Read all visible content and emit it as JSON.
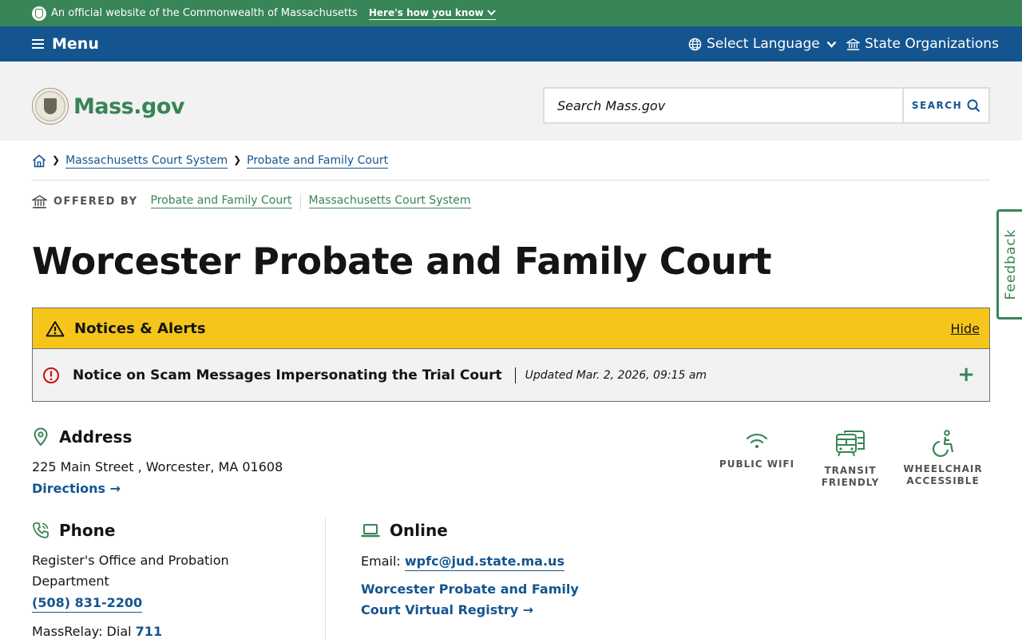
{
  "official_bar": {
    "text": "An official website of the Commonwealth of Massachusetts",
    "how_link": "Here's how you know"
  },
  "nav": {
    "menu_label": "Menu",
    "language_label": "Select Language",
    "orgs_label": "State Organizations"
  },
  "header": {
    "logo_text": "Mass.gov",
    "search_placeholder": "Search Mass.gov",
    "search_button": "SEARCH"
  },
  "breadcrumb": {
    "items": [
      "Massachusetts Court System",
      "Probate and Family Court"
    ]
  },
  "offered_by": {
    "label": "OFFERED BY",
    "links": [
      "Probate and Family Court",
      "Massachusetts Court System"
    ]
  },
  "page_title": "Worcester Probate and Family Court",
  "alerts": {
    "heading": "Notices & Alerts",
    "hide_label": "Hide",
    "items": [
      {
        "title": "Notice on Scam Messages Impersonating the Trial Court",
        "updated": "Updated Mar. 2, 2026, 09:15 am"
      }
    ]
  },
  "address": {
    "heading": "Address",
    "text": "225 Main Street , Worcester, MA 01608",
    "directions": "Directions →"
  },
  "amenities": [
    {
      "label": "PUBLIC WIFI",
      "icon": "wifi-icon"
    },
    {
      "label": "TRANSIT FRIENDLY",
      "icon": "bus-icon"
    },
    {
      "label": "WHEELCHAIR ACCESSIBLE",
      "icon": "wheelchair-icon"
    }
  ],
  "phone": {
    "heading": "Phone",
    "label": "Register's Office and Probation Department",
    "number": "(508) 831-2200",
    "relay_prefix": "MassRelay: Dial",
    "relay_number": "711"
  },
  "online": {
    "heading": "Online",
    "email_prefix": "Email:",
    "email": "wpfc@jud.state.ma.us",
    "registry_link": "Worcester Probate and Family Court Virtual Registry →"
  },
  "feedback_label": "Feedback",
  "colors": {
    "green": "#388557",
    "blue": "#14558f",
    "alert_yellow": "#f6c51b",
    "alert_red": "#cd0d0d"
  }
}
